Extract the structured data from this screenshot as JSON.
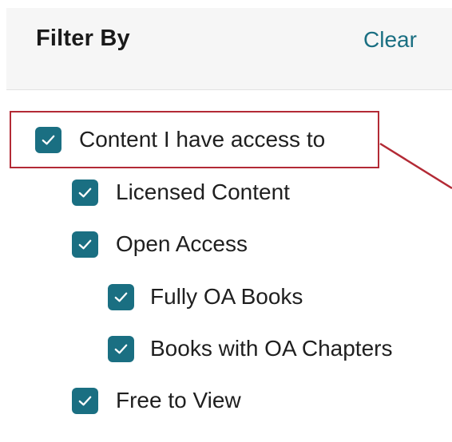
{
  "filter": {
    "title": "Filter By",
    "clear_label": "Clear",
    "accent_color": "#1a6f82",
    "highlight_color": "#b32a35",
    "options": [
      {
        "label": "Content I have access to",
        "checked": true,
        "level": 0
      },
      {
        "label": "Licensed Content",
        "checked": true,
        "level": 1
      },
      {
        "label": "Open Access",
        "checked": true,
        "level": 1
      },
      {
        "label": "Fully OA Books",
        "checked": true,
        "level": 2
      },
      {
        "label": "Books with OA Chapters",
        "checked": true,
        "level": 2
      },
      {
        "label": "Free to View",
        "checked": true,
        "level": 1
      }
    ]
  }
}
